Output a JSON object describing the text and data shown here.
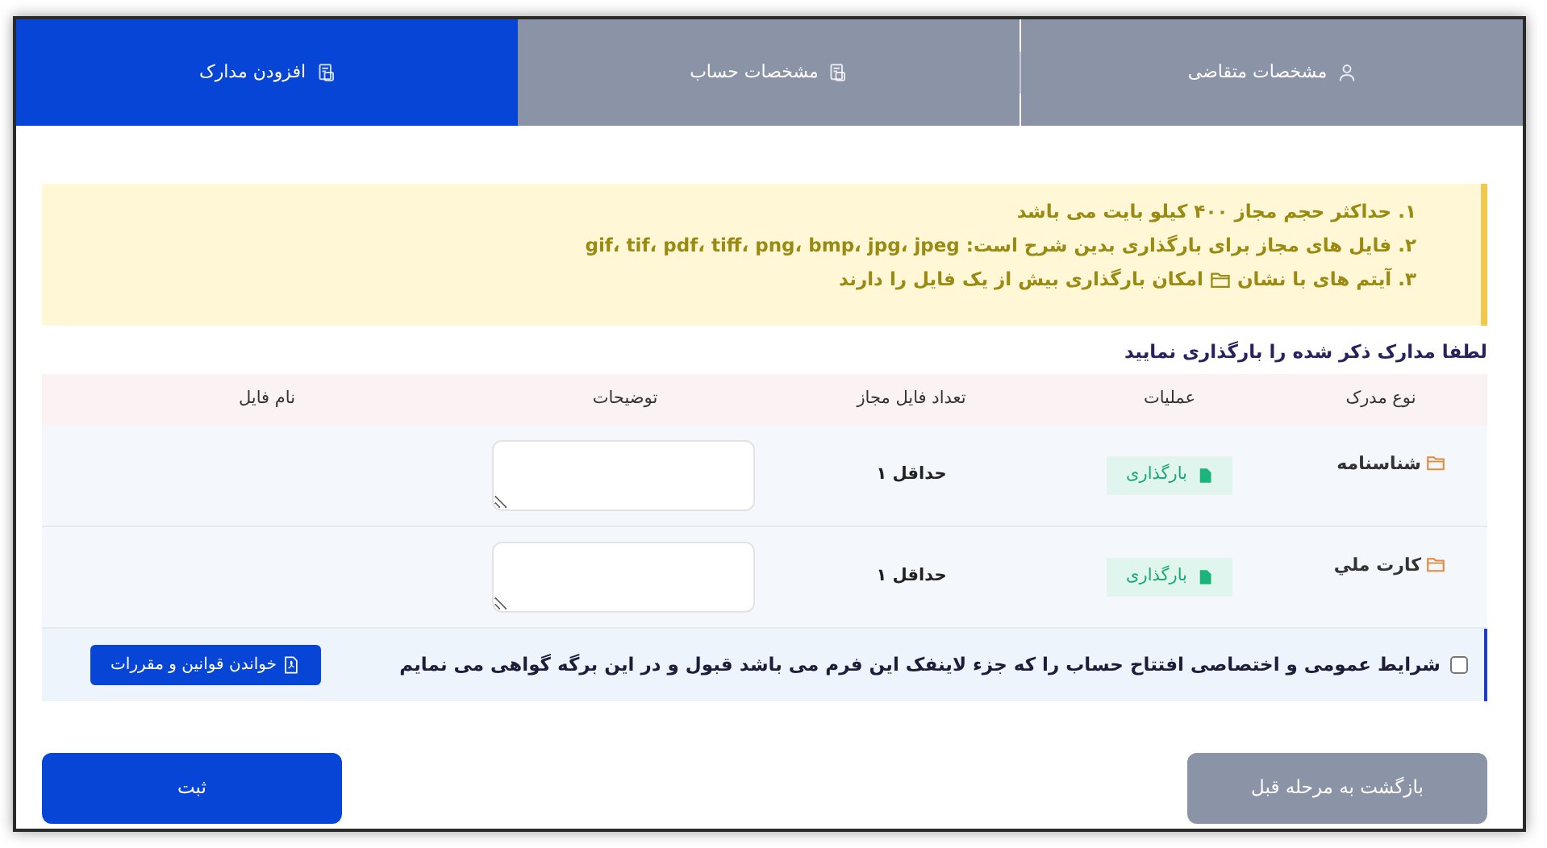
{
  "tabs": [
    {
      "label": "مشخصات متقاضی",
      "kind": "person",
      "selected": false
    },
    {
      "label": "مشخصات حساب",
      "kind": "document",
      "selected": false
    },
    {
      "label": "افزودن مدارک",
      "kind": "document",
      "selected": true
    }
  ],
  "notice": {
    "lines": [
      {
        "text": "۱. حداکثر حجم مجاز ۴۰۰ کیلو بایت می باشد"
      },
      {
        "text": "۲. فایل های مجاز برای بارگذاری بدین شرح است: gif، tif، pdf، tiff، png، bmp، jpg، jpeg"
      },
      {
        "text": "۳. آیتم های با نشان",
        "after_icon": "امکان بارگذاری بیش از یک فایل را دارند"
      }
    ]
  },
  "heading": "لطفا مدارک ذکر شده را بارگذاری نمایید",
  "table": {
    "columns": [
      "نوع مدرک",
      "عملیات",
      "تعداد فایل مجاز",
      "توضیحات",
      "نام فایل"
    ],
    "rows": [
      {
        "document": "شناسنامه",
        "action": "بارگذاری",
        "count": "حداقل ۱"
      },
      {
        "document": "كارت ملي",
        "action": "بارگذاری",
        "count": "حداقل ۱"
      }
    ]
  },
  "agreement": {
    "checked": false,
    "text": "شرایط عمومی و اختصاصی افتتاح حساب را که جزء لاینفک این فرم می باشد قبول و در این برگه گواهی می نمایم",
    "button": "خواندن قوانین و مقررات"
  },
  "buttons": [
    {
      "label": "بازگشت به مرحله قبل",
      "kind": "secondary"
    },
    {
      "label": "ثبت",
      "kind": "primary"
    }
  ]
}
